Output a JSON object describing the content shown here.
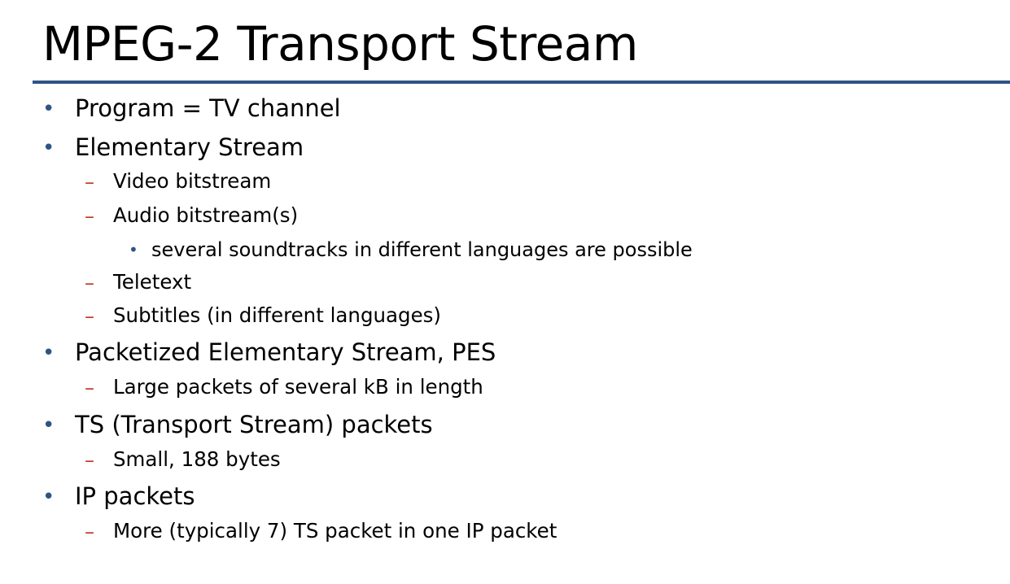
{
  "slide": {
    "title": "MPEG-2 Transport Stream",
    "colors": {
      "rule": "#2e5484",
      "bullet": "#2e5484",
      "dash": "#c0392b",
      "text": "#000000"
    },
    "bullets": [
      {
        "level": 1,
        "text": "Program = TV channel"
      },
      {
        "level": 1,
        "text": "Elementary Stream"
      },
      {
        "level": 2,
        "text": "Video bitstream"
      },
      {
        "level": 2,
        "text": "Audio bitstream(s)"
      },
      {
        "level": 3,
        "text": "several soundtracks in different languages are possible"
      },
      {
        "level": 2,
        "text": "Teletext"
      },
      {
        "level": 2,
        "text": "Subtitles (in different languages)"
      },
      {
        "level": 1,
        "text": "Packetized Elementary Stream, PES"
      },
      {
        "level": 2,
        "text": "Large packets of several kB in length"
      },
      {
        "level": 1,
        "text": "TS (Transport Stream) packets"
      },
      {
        "level": 2,
        "text": "Small, 188 bytes"
      },
      {
        "level": 1,
        "text": "IP packets"
      },
      {
        "level": 2,
        "text": "More (typically 7) TS packet in one IP packet"
      }
    ]
  }
}
